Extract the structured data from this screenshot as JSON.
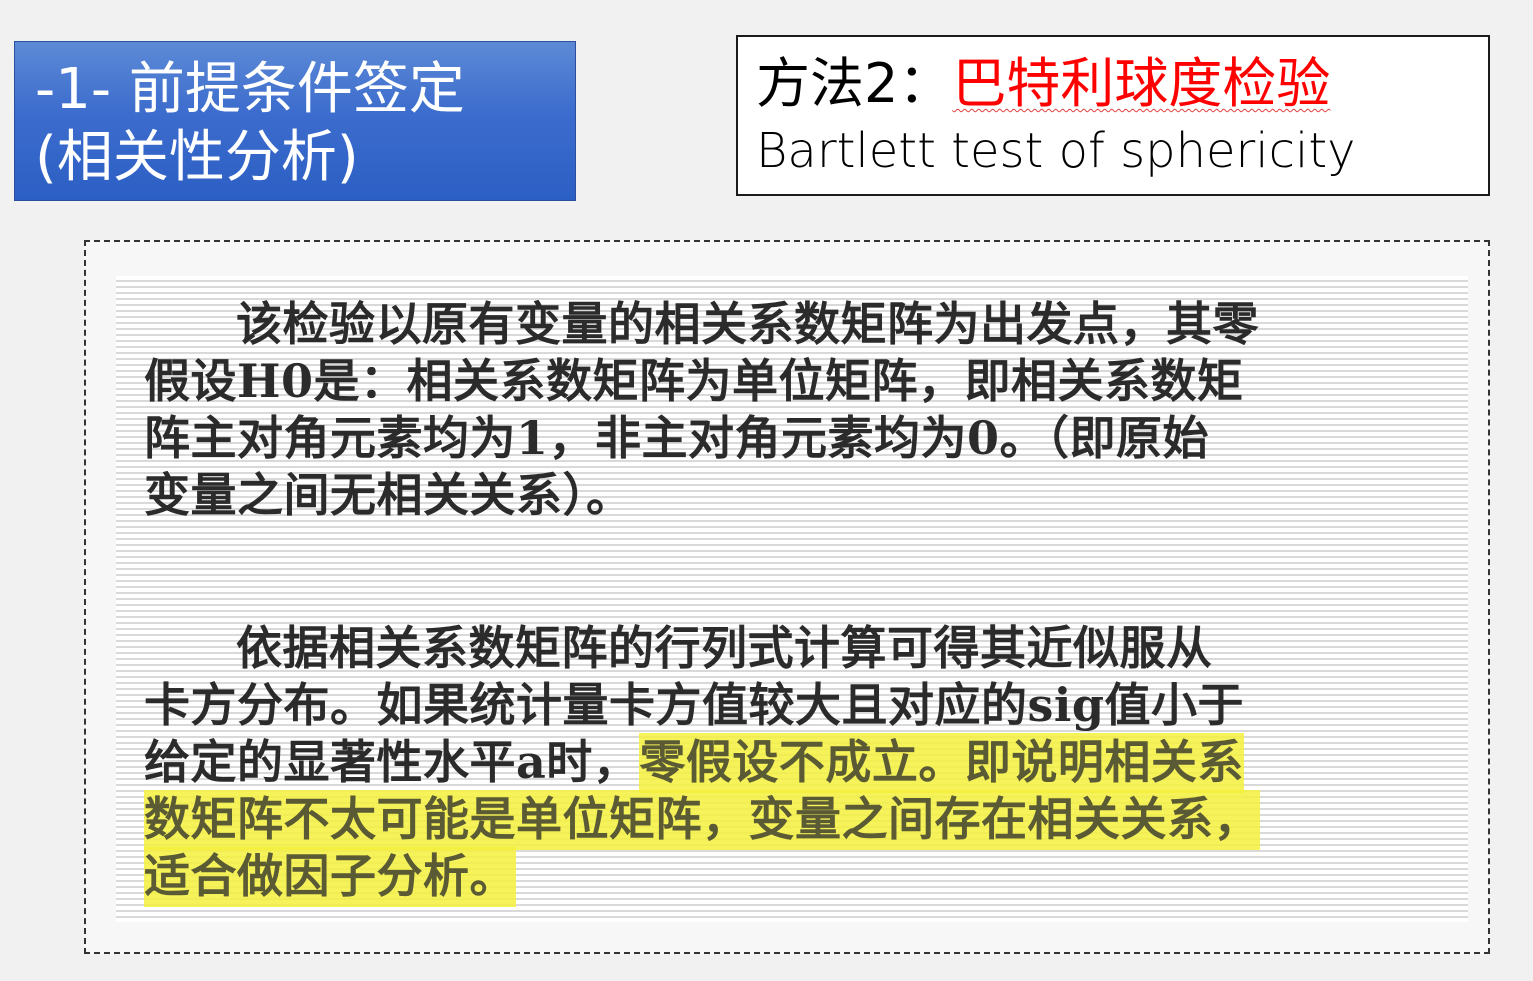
{
  "section_banner": {
    "line1": "-1- 前提条件签定",
    "line2": " (相关性分析)",
    "colors": {
      "background": "#3c6ccd",
      "text": "#ffffff"
    }
  },
  "method_box": {
    "prefix": "方法2：",
    "name_cn": "巴特利球度检验",
    "name_en": "Bartlett test of sphericity",
    "colors": {
      "name_cn": "#ff0000",
      "text": "#000000"
    }
  },
  "scan": {
    "paragraph1": {
      "lines": [
        "该检验以原有变量的相关系数矩阵为出发点，其零",
        "假设H0是：相关系数矩阵为单位矩阵，即相关系数矩",
        "阵主对角元素均为1，非主对角元素均为0。（即原始",
        "变量之间无相关关系）。"
      ]
    },
    "paragraph2": {
      "line1": "依据相关系数矩阵的行列式计算可得其近似服从",
      "line2": "卡方分布。如果统计量卡方值较大且对应的sig值小于",
      "line3_plain": "给定的显著性水平a时，",
      "line3_highlight": "零假设不成立。即说明相关系",
      "line4_highlight": "数矩阵不太可能是单位矩阵，变量之间存在相关关系，",
      "line5_highlight": "适合做因子分析。"
    },
    "colors": {
      "highlight": "#f5f03c"
    }
  }
}
